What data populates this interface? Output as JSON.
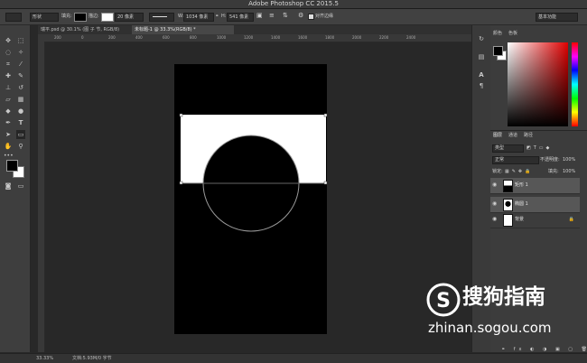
{
  "window": {
    "title": "Adobe Photoshop CC 2015.5"
  },
  "options_bar": {
    "shape_mode": "形状",
    "fill_label": "填充:",
    "stroke_label": "描边:",
    "stroke_size": "20 像素",
    "width_label": "W:",
    "width_value": "1034 像素",
    "height_label": "H:",
    "height_value": "541 像素",
    "align_edges": "对齐边缘",
    "workspace": "基本功能"
  },
  "tabs": [
    {
      "label": "瑞平.psd @ 30.1% (图 子 节, RGB/8)"
    },
    {
      "label": "未标题-1 @ 33.3%(RGB/8) *"
    }
  ],
  "ruler_ticks": [
    "200",
    "0",
    "200",
    "400",
    "600",
    "800",
    "1000",
    "1200",
    "1400",
    "1600",
    "1800",
    "2000",
    "2200",
    "2400"
  ],
  "panels": {
    "color_tabs": [
      "颜色",
      "色板"
    ],
    "layers_tabs": [
      "图层",
      "通道",
      "路径"
    ],
    "kind_label": "类型",
    "blend_mode": "正常",
    "opacity_label": "不透明度:",
    "opacity_value": "100%",
    "lock_label": "锁定:",
    "fill_label": "填充:",
    "fill_value": "100%",
    "layers": [
      {
        "name": "矩形 1",
        "selected": true
      },
      {
        "name": "椭圆 1",
        "selected": true
      },
      {
        "name": "背景",
        "selected": false
      }
    ]
  },
  "status": {
    "zoom": "33.33%",
    "doc_info": "文档:5.93M/0 字节"
  },
  "watermark": {
    "brand": "搜狗指南",
    "url": "zhinan.sogou.com"
  },
  "colors": {
    "foreground": "#000000",
    "background": "#ffffff",
    "picker_hue": "#e00000"
  }
}
